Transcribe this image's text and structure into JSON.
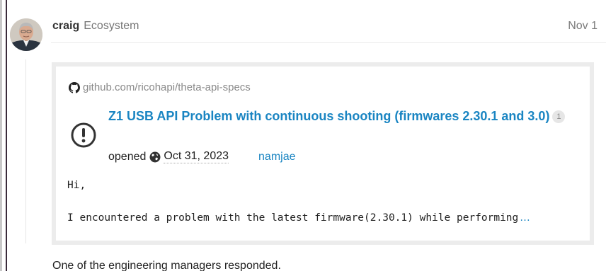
{
  "post": {
    "username": "craig",
    "category": "Ecosystem",
    "date": "Nov 1",
    "body_text": "One of the engineering managers responded."
  },
  "onebox": {
    "source": "github.com/ricohapi/theta-api-specs",
    "issue_title": "Z1 USB API Problem with continuous shooting (firmwares 2.30.1 and 3.0)",
    "comment_count": "1",
    "opened_label": "opened",
    "opened_date": "Oct 31, 2023",
    "author": "namjae",
    "body_line_1": "Hi,",
    "body_line_2": "I encountered a problem with the latest firmware(2.30.1) while performing",
    "ellipsis": "…"
  },
  "icons": {
    "source": "github-icon",
    "issue": "issue-open-icon",
    "globe": "globe-icon"
  },
  "colors": {
    "link": "#1a85c2",
    "muted": "#7a7a7a",
    "border": "#ececec",
    "accent_bar": "#3a2a3a"
  }
}
